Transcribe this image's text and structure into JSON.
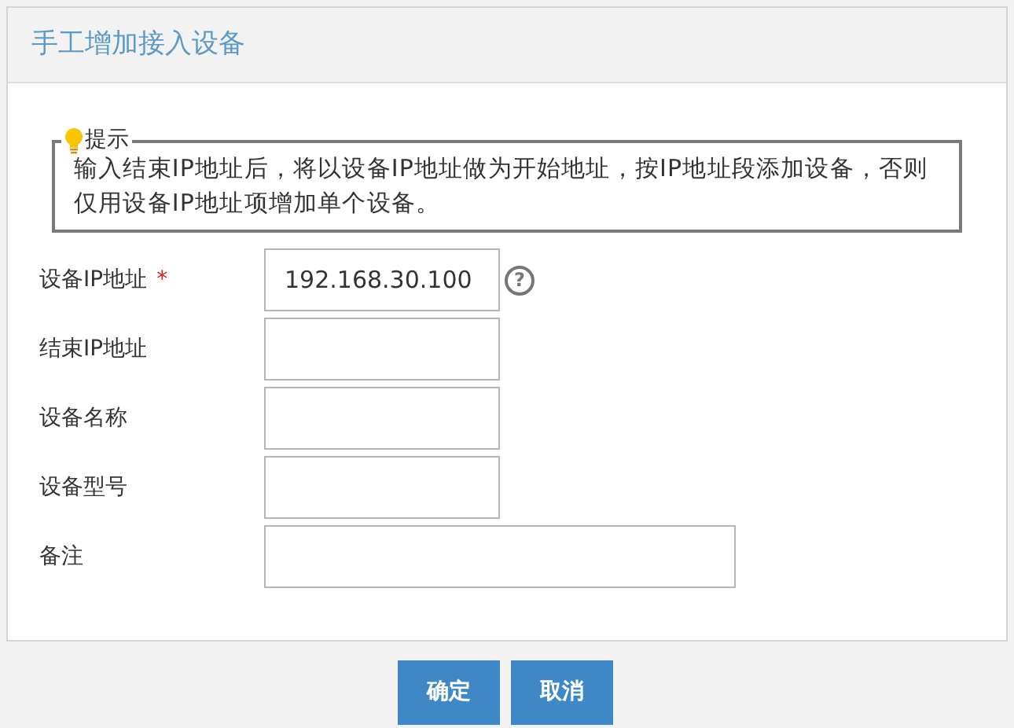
{
  "panel": {
    "title": "手工增加接入设备"
  },
  "tip": {
    "legend": "提示",
    "text": "输入结束IP地址后，将以设备IP地址做为开始地址，按IP地址段添加设备，否则仅用设备IP地址项增加单个设备。"
  },
  "fields": [
    {
      "label": "设备IP地址",
      "required": true,
      "value": "192.168.30.100",
      "help": true,
      "kind": "short"
    },
    {
      "label": "结束IP地址",
      "required": false,
      "help": false,
      "kind": "short"
    },
    {
      "label": "设备名称",
      "required": false,
      "help": false,
      "kind": "short"
    },
    {
      "label": "设备型号",
      "required": false,
      "help": false,
      "kind": "short"
    },
    {
      "label": "备注",
      "required": false,
      "help": false,
      "kind": "wide"
    }
  ],
  "required_mark": "*",
  "help_mark": "?",
  "buttons": [
    "确定",
    "取消"
  ]
}
